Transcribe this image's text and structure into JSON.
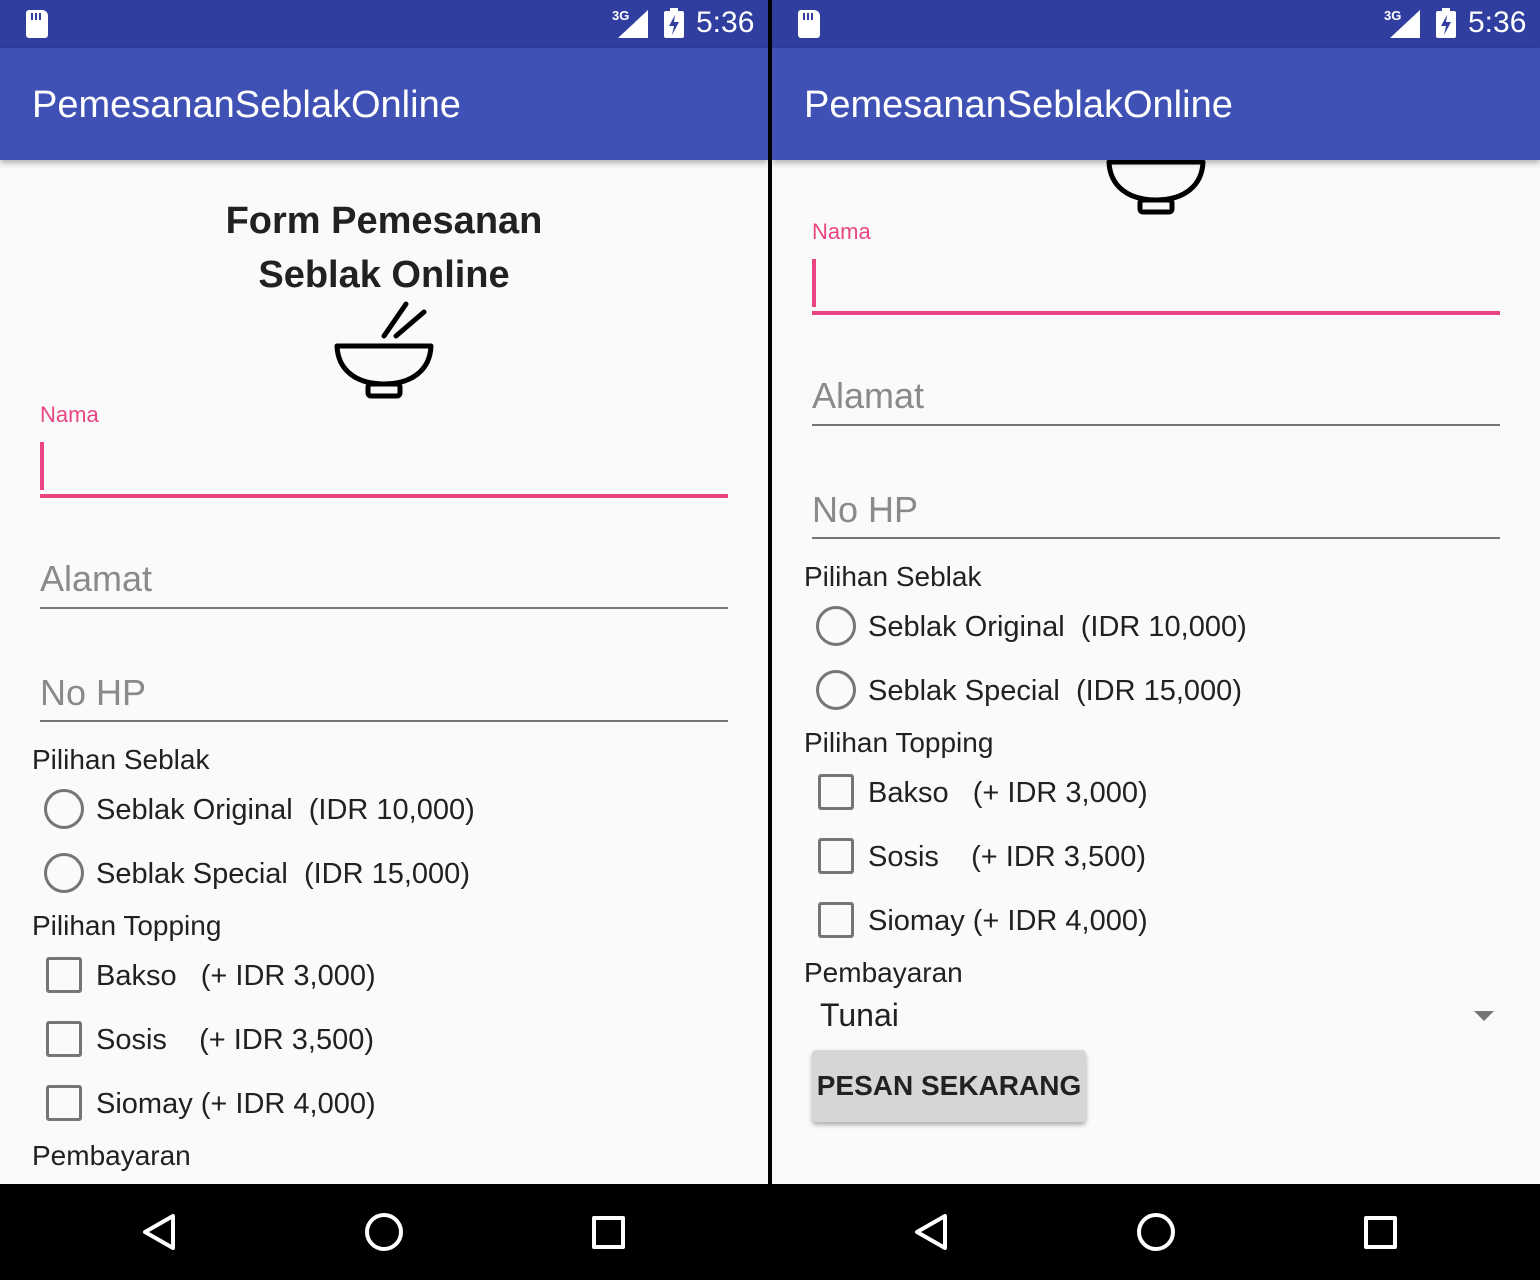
{
  "status_bar": {
    "network": "3G",
    "time": "5:36"
  },
  "app_bar": {
    "title": "PemesananSeblakOnline"
  },
  "form": {
    "title_line1": "Form Pemesanan",
    "title_line2": "Seblak Online",
    "nama": {
      "label": "Nama",
      "value": ""
    },
    "alamat": {
      "placeholder": "Alamat"
    },
    "no_hp": {
      "placeholder": "No HP"
    },
    "pilihan_seblak": {
      "label": "Pilihan Seblak",
      "options": [
        {
          "label": "Seblak Original  (IDR 10,000)",
          "checked": false
        },
        {
          "label": "Seblak Special  (IDR 15,000)",
          "checked": false
        }
      ]
    },
    "pilihan_topping": {
      "label": "Pilihan Topping",
      "options": [
        {
          "label": "Bakso   (+ IDR 3,000)",
          "checked": false
        },
        {
          "label": "Sosis    (+ IDR 3,500)",
          "checked": false
        },
        {
          "label": "Siomay (+ IDR 4,000)",
          "checked": false
        }
      ]
    },
    "pembayaran": {
      "label": "Pembayaran",
      "selected": "Tunai"
    },
    "submit_label": "PESAN SEKARANG"
  },
  "colors": {
    "status_bar": "#303f9f",
    "app_bar": "#3f51b5",
    "accent": "#e94583",
    "background": "#fafafa"
  },
  "icons": {
    "bowl": "bowl-with-chopsticks-icon",
    "sd_card": "sd-card-icon",
    "signal": "signal-icon",
    "battery": "battery-charging-icon",
    "nav": [
      "back-icon",
      "home-icon",
      "recents-icon"
    ]
  }
}
